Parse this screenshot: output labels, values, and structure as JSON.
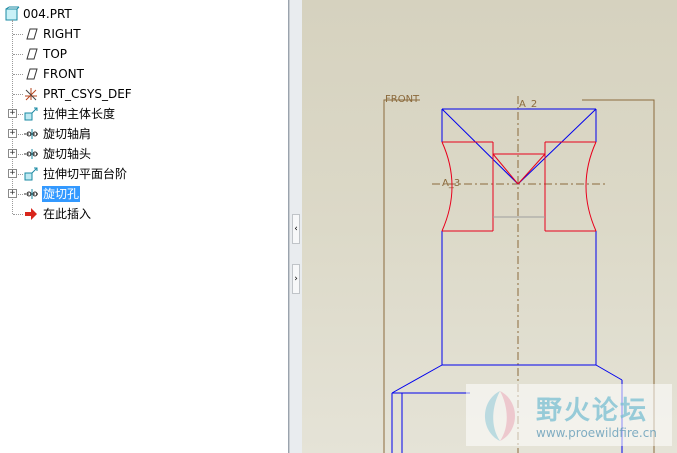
{
  "model_tree": {
    "root": {
      "label": "004.PRT",
      "icon": "part-icon"
    },
    "items": [
      {
        "label": "RIGHT",
        "icon": "datum-plane-icon",
        "expandable": false
      },
      {
        "label": "TOP",
        "icon": "datum-plane-icon",
        "expandable": false
      },
      {
        "label": "FRONT",
        "icon": "datum-plane-icon",
        "expandable": false
      },
      {
        "label": "PRT_CSYS_DEF",
        "icon": "coordinate-system-icon",
        "expandable": false
      },
      {
        "label": "拉伸主体长度",
        "icon": "extrude-icon",
        "expandable": true
      },
      {
        "label": "旋切轴肩",
        "icon": "revolve-icon",
        "expandable": true
      },
      {
        "label": "旋切轴头",
        "icon": "revolve-icon",
        "expandable": true
      },
      {
        "label": "拉伸切平面台阶",
        "icon": "extrude-icon",
        "expandable": true
      },
      {
        "label": "旋切孔",
        "icon": "revolve-icon",
        "expandable": true,
        "selected": true
      },
      {
        "label": "在此插入",
        "icon": "insert-here-arrow-icon",
        "expandable": false
      }
    ]
  },
  "splitter": {
    "collapse_glyph": "‹",
    "expand_glyph": "›"
  },
  "graphics": {
    "datum_plane_label": "FRONT",
    "axis_labels": [
      "A_2",
      "A_3"
    ],
    "colors": {
      "background": "#dcd9c8",
      "datum": "#8b6a3c",
      "geometry": "#0000ee",
      "highlight": "#e8001c",
      "axis": "#8b6a3c"
    }
  },
  "watermark": {
    "title": "野火论坛",
    "url": "www.proewildfire.cn"
  }
}
